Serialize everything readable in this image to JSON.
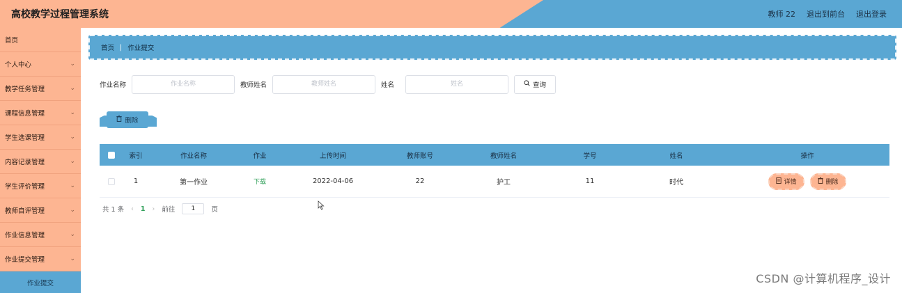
{
  "header": {
    "app_title": "高校教学过程管理系统",
    "user_label": "教师 22",
    "back_to_front": "退出到前台",
    "logout": "退出登录"
  },
  "sidebar": {
    "items": [
      {
        "label": "首页"
      },
      {
        "label": "个人中心"
      },
      {
        "label": "教学任务管理"
      },
      {
        "label": "课程信息管理"
      },
      {
        "label": "学生选课管理"
      },
      {
        "label": "内容记录管理"
      },
      {
        "label": "学生评价管理"
      },
      {
        "label": "教师自评管理"
      },
      {
        "label": "作业信息管理"
      },
      {
        "label": "作业提交管理"
      }
    ],
    "active_sub": "作业提交"
  },
  "breadcrumb": {
    "home": "首页",
    "separator": "|",
    "current": "作业提交"
  },
  "search": {
    "homework_name_label": "作业名称",
    "homework_name_placeholder": "作业名称",
    "teacher_name_label": "教师姓名",
    "teacher_name_placeholder": "教师姓名",
    "student_name_label": "姓名",
    "student_name_placeholder": "姓名",
    "query_button": "查询"
  },
  "toolbar": {
    "delete_button": "删除"
  },
  "table": {
    "columns": [
      "索引",
      "作业名称",
      "作业",
      "上传时间",
      "教师账号",
      "教师姓名",
      "学号",
      "姓名",
      "操作"
    ],
    "rows": [
      {
        "index": "1",
        "homework_name": "第一作业",
        "homework_link": "下载",
        "upload_time": "2022-04-06",
        "teacher_account": "22",
        "teacher_name": "护工",
        "student_id": "11",
        "student_name": "时代",
        "detail_button": "详情",
        "delete_button": "删除"
      }
    ]
  },
  "pagination": {
    "total_text": "共 1 条",
    "current_page": "1",
    "goto_label": "前往",
    "goto_value": "1",
    "page_suffix": "页"
  },
  "watermark": "CSDN @计算机程序_设计",
  "colors": {
    "accent_blue": "#5aa7d3",
    "accent_peach": "#fdb592",
    "link_green": "#31a05a"
  }
}
